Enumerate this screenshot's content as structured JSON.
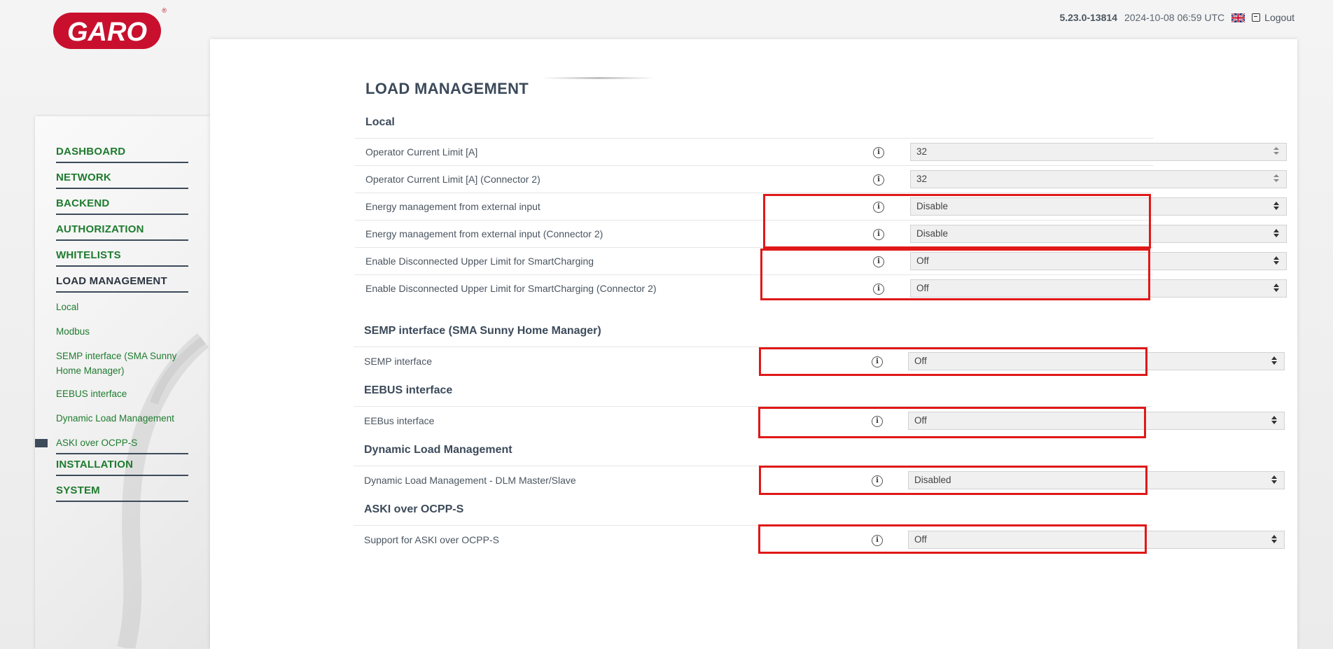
{
  "brand": {
    "logo_text": "GARO",
    "registered": "®"
  },
  "topbar": {
    "version": "5.23.0-13814",
    "datetime": "2024-10-08 06:59 UTC",
    "language_icon": "uk-flag-icon",
    "logout_label": "Logout"
  },
  "sidebar": {
    "items": [
      {
        "label": "DASHBOARD"
      },
      {
        "label": "NETWORK"
      },
      {
        "label": "BACKEND"
      },
      {
        "label": "AUTHORIZATION"
      },
      {
        "label": "WHITELISTS"
      },
      {
        "label": "LOAD MANAGEMENT"
      },
      {
        "label": "INSTALLATION"
      },
      {
        "label": "SYSTEM"
      }
    ],
    "subitems": [
      {
        "label": "Local"
      },
      {
        "label": "Modbus"
      },
      {
        "label": "SEMP interface (SMA Sunny Home Manager)"
      },
      {
        "label": "EEBUS interface"
      },
      {
        "label": "Dynamic Load Management"
      },
      {
        "label": "ASKI over OCPP-S"
      }
    ]
  },
  "page": {
    "title": "LOAD MANAGEMENT",
    "sections": {
      "local": {
        "title": "Local",
        "rows": [
          {
            "label": "Operator Current Limit [A]",
            "value": "32"
          },
          {
            "label": "Operator Current Limit [A] (Connector 2)",
            "value": "32"
          },
          {
            "label": "Energy management from external input",
            "value": "Disable"
          },
          {
            "label": "Energy management from external input (Connector 2)",
            "value": "Disable"
          },
          {
            "label": "Enable Disconnected Upper Limit for SmartCharging",
            "value": "Off"
          },
          {
            "label": "Enable Disconnected Upper Limit for SmartCharging (Connector 2)",
            "value": "Off"
          }
        ]
      },
      "semp": {
        "title": "SEMP interface (SMA Sunny Home Manager)",
        "rows": [
          {
            "label": "SEMP interface",
            "value": "Off"
          }
        ]
      },
      "eebus": {
        "title": "EEBUS interface",
        "rows": [
          {
            "label": "EEBus interface",
            "value": "Off"
          }
        ]
      },
      "dlm": {
        "title": "Dynamic Load Management",
        "rows": [
          {
            "label": "Dynamic Load Management - DLM Master/Slave",
            "value": "Disabled"
          }
        ]
      },
      "aski": {
        "title": "ASKI over OCPP-S",
        "rows": [
          {
            "label": "Support for ASKI over OCPP-S",
            "value": "Off"
          }
        ]
      }
    }
  },
  "colors": {
    "accent_green": "#1e7b2e",
    "highlight_red": "#e01818",
    "text": "#3c4a5a"
  }
}
